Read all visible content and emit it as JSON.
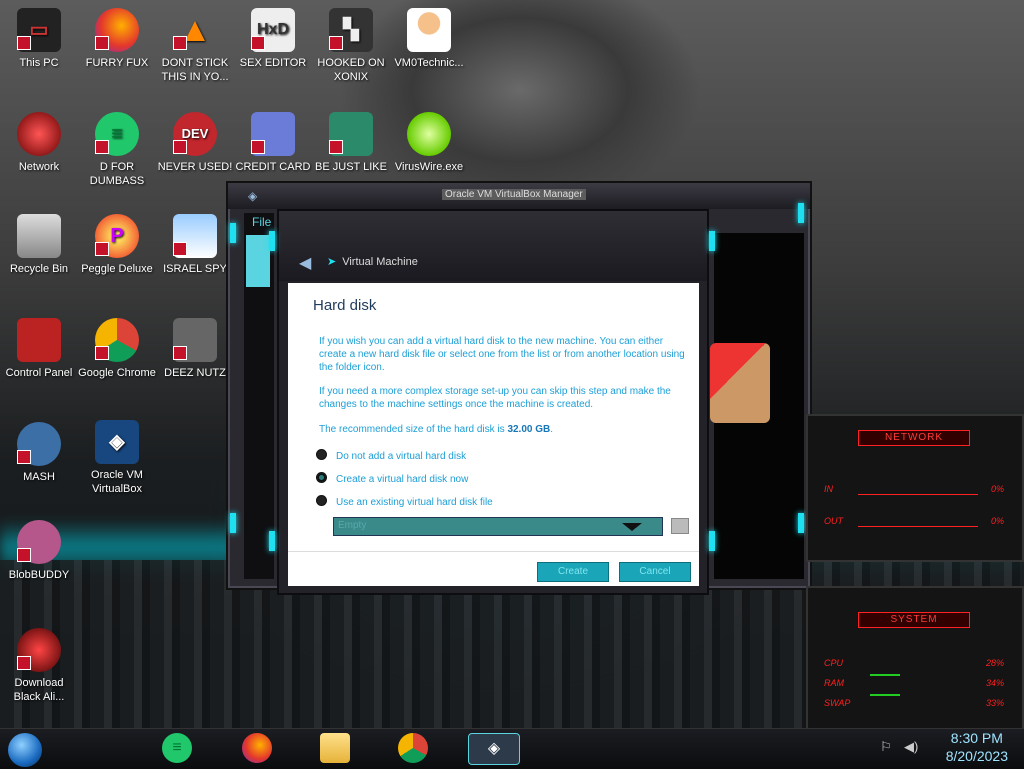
{
  "desktop_icons": [
    {
      "label": "This PC",
      "icon": "monitor-icon"
    },
    {
      "label": "FURRY FUX",
      "icon": "firefox-icon"
    },
    {
      "label": "DONT STICK THIS IN YO...",
      "icon": "vlc-cone-icon"
    },
    {
      "label": "SEX EDITOR",
      "icon": "hxd-icon"
    },
    {
      "label": "HOOKED ON XONIX",
      "icon": "xonix-icon"
    },
    {
      "label": "VM0Technic...",
      "icon": "doctor-icon"
    },
    {
      "label": "Network",
      "icon": "network-orb-icon"
    },
    {
      "label": "D FOR DUMBASS",
      "icon": "green-d-icon"
    },
    {
      "label": "NEVER USED!",
      "icon": "dev-cpp-icon"
    },
    {
      "label": "CREDIT CARD ...",
      "icon": "credit-card-icon"
    },
    {
      "label": "BE JUST LIKE ...",
      "icon": "santa-game-icon"
    },
    {
      "label": "VirusWire.exe",
      "icon": "lime-icon"
    },
    {
      "label": "Recycle Bin",
      "icon": "recycle-bin-icon"
    },
    {
      "label": "Peggle Deluxe",
      "icon": "peggle-icon"
    },
    {
      "label": "ISRAEL SPY",
      "icon": "spy-window-icon"
    },
    {
      "label": "Control Panel",
      "icon": "control-panel-icon"
    },
    {
      "label": "Google Chrome",
      "icon": "chrome-icon"
    },
    {
      "label": "DEEZ NUTZ",
      "icon": "windows-stack-icon"
    },
    {
      "label": "MASH",
      "icon": "mash-icon"
    },
    {
      "label": "Oracle VM VirtualBox",
      "icon": "virtualbox-icon"
    },
    {
      "label": "BlobBUDDY",
      "icon": "blob-icon"
    },
    {
      "label": "Download Black Ali...",
      "icon": "red-orb-icon"
    }
  ],
  "vbox_window": {
    "title": "Oracle VM VirtualBox Manager",
    "menu_file": "File"
  },
  "wizard": {
    "header": "Virtual Machine",
    "heading": "Hard disk",
    "para1": "If you wish you can add a virtual hard disk to the new machine. You can either create a new hard disk file or select one from the list or from another location using the folder icon.",
    "para2": "If you need a more complex storage set-up you can skip this step and make the changes to the machine settings once the machine is created.",
    "para3_prefix": "The recommended size of the hard disk is ",
    "para3_size": "32.00 GB",
    "options": [
      {
        "label": "Do not add a virtual hard disk",
        "selected": false
      },
      {
        "label": "Create a virtual hard disk now",
        "selected": true
      },
      {
        "label": "Use an existing virtual hard disk file",
        "selected": false
      }
    ],
    "combo_value": "Empty",
    "create_label": "Create",
    "cancel_label": "Cancel"
  },
  "network_widget": {
    "title": "NETWORK",
    "in_label": "IN",
    "out_label": "OUT",
    "in_value": "0%",
    "out_value": "0%"
  },
  "system_widget": {
    "title": "SYSTEM",
    "cpu_label": "CPU",
    "ram_label": "RAM",
    "swap_label": "SWAP",
    "cpu_value": "28%",
    "ram_value": "34%",
    "swap_value": "33%"
  },
  "taskbar": {
    "time": "8:30 PM",
    "date": "8/20/2023"
  },
  "colors": {
    "accent_cyan": "#1ee0f0",
    "text_blue": "#1c9fd6",
    "widget_red": "#ff2020"
  }
}
